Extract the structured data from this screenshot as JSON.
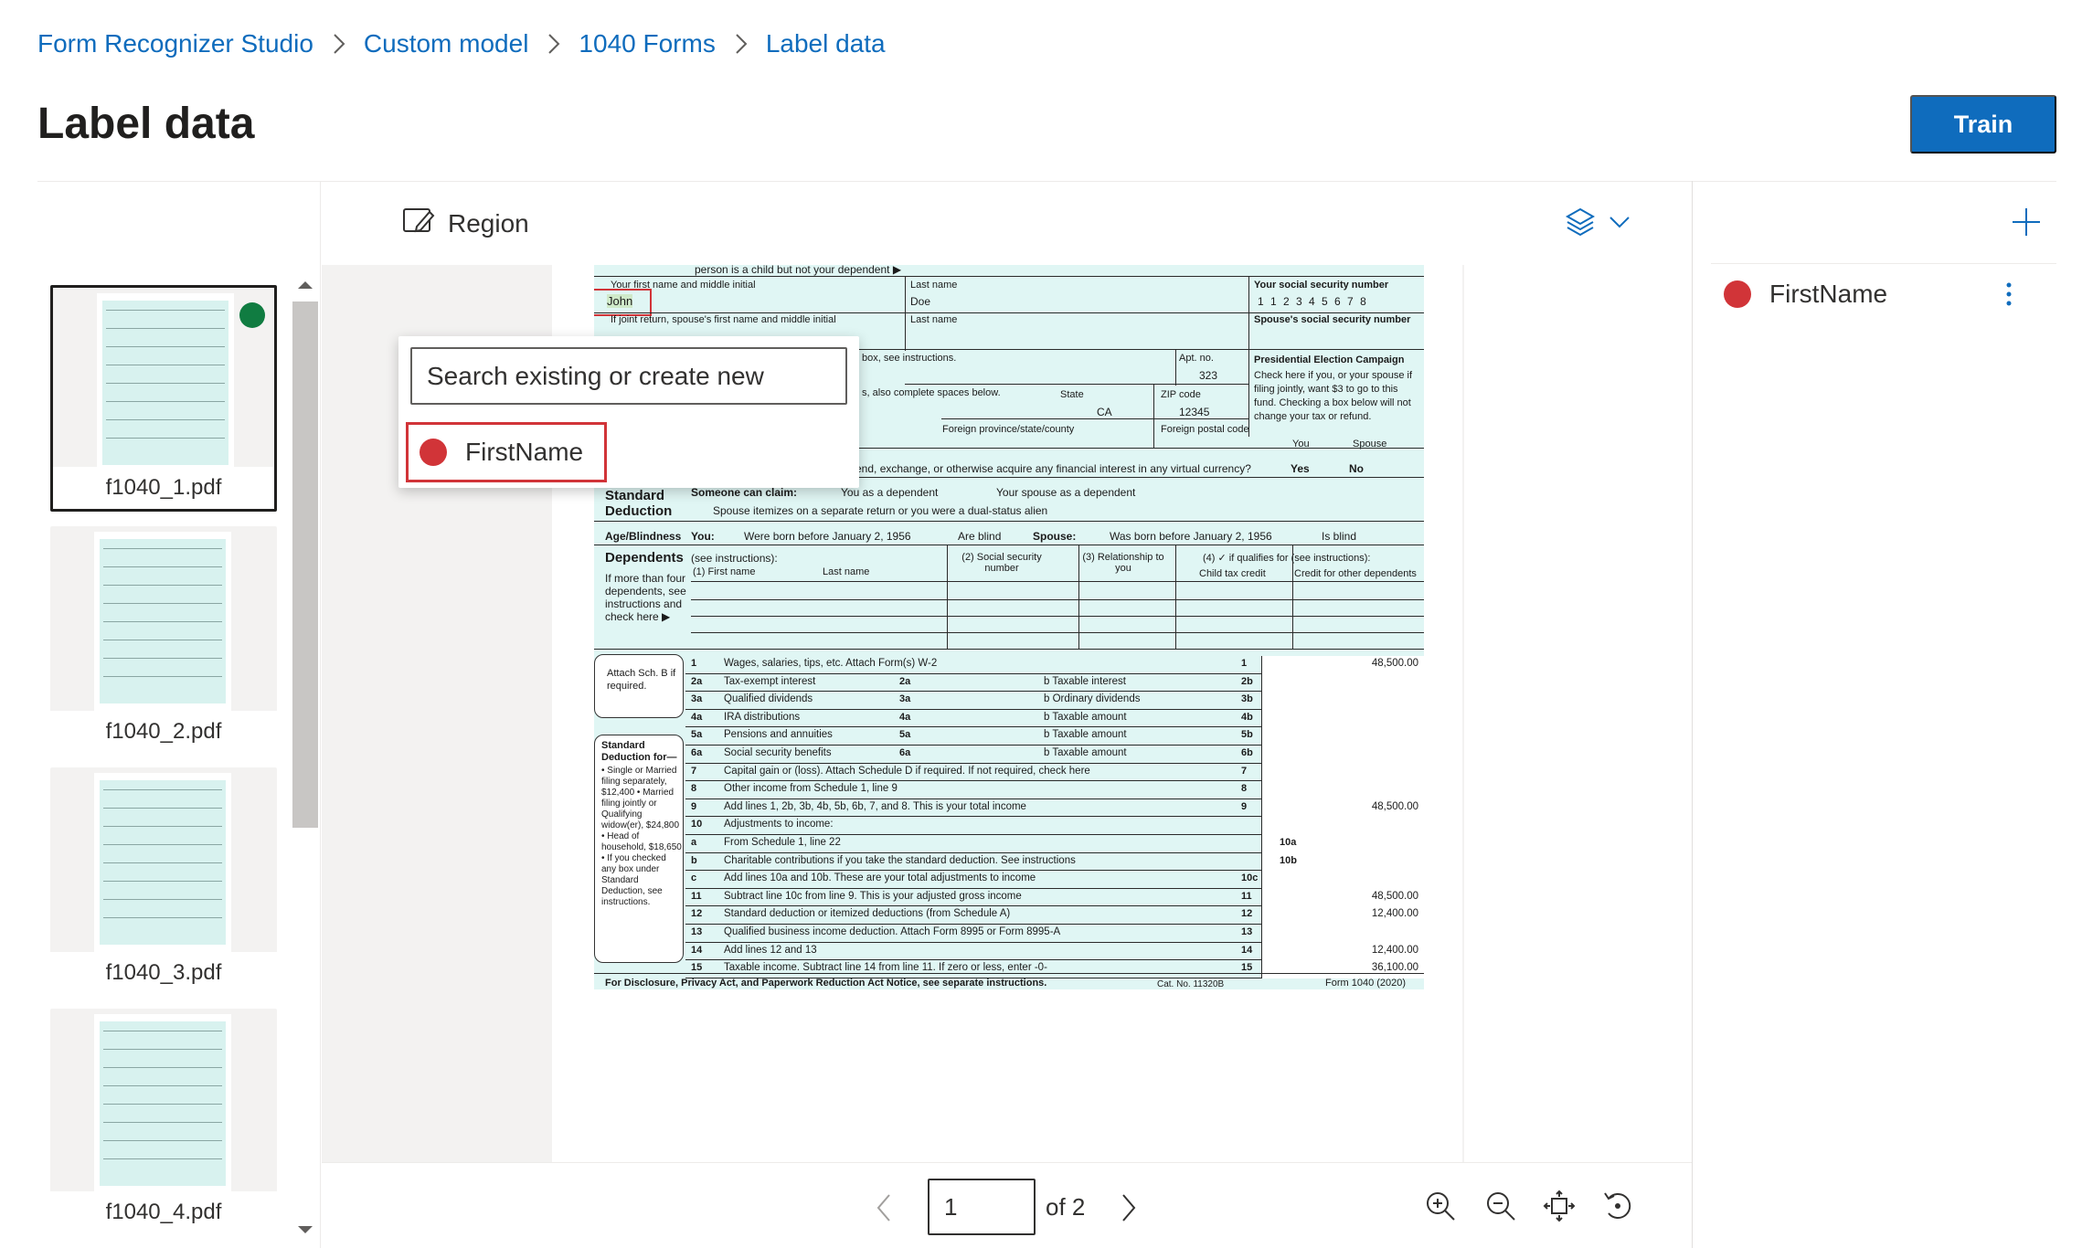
{
  "breadcrumb": {
    "items": [
      "Form Recognizer Studio",
      "Custom model",
      "1040 Forms",
      "Label data"
    ]
  },
  "page": {
    "title": "Label data",
    "train_label": "Train"
  },
  "toolbar": {
    "region_label": "Region"
  },
  "files": [
    {
      "name": "f1040_1.pdf",
      "labeled": true
    },
    {
      "name": "f1040_2.pdf"
    },
    {
      "name": "f1040_3.pdf"
    },
    {
      "name": "f1040_4.pdf"
    }
  ],
  "popup": {
    "search_placeholder": "Search existing or create new",
    "option": "FirstName"
  },
  "fields": [
    {
      "name": "FirstName",
      "color": "#d13438"
    }
  ],
  "pager": {
    "current": "1",
    "of_label": "of 2"
  },
  "form": {
    "first_name_value": "John",
    "last_name_value": "Doe",
    "ssn_value": "1 1 2 3 4 5 6 7 8",
    "lbl_firstname": "Your first name and middle initial",
    "lbl_lastname": "Last name",
    "lbl_ssn": "Your social security number",
    "lbl_spouse": "If joint return, spouse's first name and middle initial",
    "lbl_spouse_last": "Last name",
    "lbl_spouse_ssn": "Spouse's social security number",
    "top_line": "person is a child but not your dependent ▶",
    "aptno": "Apt. no.",
    "aptno_val": "323",
    "state": "State",
    "state_val": "CA",
    "zip": "ZIP code",
    "zip_val": "12345",
    "pec": "Presidential Election Campaign",
    "pec_text": "Check here if you, or your spouse if filing jointly, want $3 to go to this fund. Checking a box below will not change your tax or refund.",
    "you": "You",
    "spouse": "Spouse",
    "box_instr": "box, see instructions.",
    "also_complete": "s, also complete spaces below.",
    "foreign1": "Foreign province/state/county",
    "foreign2": "Foreign postal code",
    "virtual": "end, exchange, or otherwise acquire any financial interest in any virtual currency?",
    "yes": "Yes",
    "no": "No",
    "std_ded": "Standard Deduction",
    "claim": "Someone can claim:",
    "dep1": "You as a dependent",
    "dep2": "Your spouse as a dependent",
    "itemizes": "Spouse itemizes on a separate return or you were a dual-status alien",
    "age": "Age/Blindness",
    "you2": "You:",
    "born": "Were born before January 2, 1956",
    "blind": "Are blind",
    "spouse2": "Spouse:",
    "born2": "Was born before January 2, 1956",
    "blind2": "Is blind",
    "dependents": "Dependents",
    "see_instr": "(see instructions):",
    "dep_h1": "(1) First name",
    "dep_h1b": "Last name",
    "dep_h2": "(2) Social security number",
    "dep_h3": "(3) Relationship to you",
    "dep_h4": "(4) ✓ if qualifies for (see instructions):",
    "dep_h5": "Child tax credit",
    "dep_h6": "Credit for other dependents",
    "dep_side": "If more than four dependents, see instructions and check here ▶",
    "attach": "Attach Sch. B if required.",
    "stdside": "Standard Deduction for—",
    "stdside_items": "• Single or Married filing separately, $12,400 • Married filing jointly or Qualifying widow(er), $24,800 • Head of household, $18,650 • If you checked any box under Standard Deduction, see instructions.",
    "lines": [
      {
        "n": "1",
        "t": "Wages, salaries, tips, etc. Attach Form(s) W-2",
        "r": "1",
        "v": "48,500.00"
      },
      {
        "n": "2a",
        "t": "Tax-exempt interest",
        "b": "2a",
        "bt": "b  Taxable interest",
        "r": "2b",
        "v": ""
      },
      {
        "n": "3a",
        "t": "Qualified dividends",
        "b": "3a",
        "bt": "b  Ordinary dividends",
        "r": "3b",
        "v": ""
      },
      {
        "n": "4a",
        "t": "IRA distributions",
        "b": "4a",
        "bt": "b  Taxable amount",
        "r": "4b",
        "v": ""
      },
      {
        "n": "5a",
        "t": "Pensions and annuities",
        "b": "5a",
        "bt": "b  Taxable amount",
        "r": "5b",
        "v": ""
      },
      {
        "n": "6a",
        "t": "Social security benefits",
        "b": "6a",
        "bt": "b  Taxable amount",
        "r": "6b",
        "v": ""
      },
      {
        "n": "7",
        "t": "Capital gain or (loss). Attach Schedule D if required. If not required, check here",
        "r": "7",
        "v": ""
      },
      {
        "n": "8",
        "t": "Other income from Schedule 1, line 9",
        "r": "8",
        "v": ""
      },
      {
        "n": "9",
        "t": "Add lines 1, 2b, 3b, 4b, 5b, 6b, 7, and 8. This is your total income",
        "r": "9",
        "v": "48,500.00"
      },
      {
        "n": "10",
        "t": "Adjustments to income:",
        "r": "",
        "v": ""
      },
      {
        "n": "a",
        "t": "From Schedule 1, line 22",
        "b": "10a",
        "r": "",
        "v": ""
      },
      {
        "n": "b",
        "t": "Charitable contributions if you take the standard deduction. See instructions",
        "b": "10b",
        "r": "",
        "v": ""
      },
      {
        "n": "c",
        "t": "Add lines 10a and 10b. These are your total adjustments to income",
        "r": "10c",
        "v": ""
      },
      {
        "n": "11",
        "t": "Subtract line 10c from line 9. This is your adjusted gross income",
        "r": "11",
        "v": "48,500.00"
      },
      {
        "n": "12",
        "t": "Standard deduction or itemized deductions (from Schedule A)",
        "r": "12",
        "v": "12,400.00"
      },
      {
        "n": "13",
        "t": "Qualified business income deduction. Attach Form 8995 or Form 8995-A",
        "r": "13",
        "v": ""
      },
      {
        "n": "14",
        "t": "Add lines 12 and 13",
        "r": "14",
        "v": "12,400.00"
      },
      {
        "n": "15",
        "t": "Taxable income. Subtract line 14 from line 11. If zero or less, enter -0-",
        "r": "15",
        "v": "36,100.00"
      }
    ],
    "footer": "For Disclosure, Privacy Act, and Paperwork Reduction Act Notice, see separate instructions.",
    "cat": "Cat. No. 11320B",
    "formno": "Form 1040 (2020)"
  }
}
